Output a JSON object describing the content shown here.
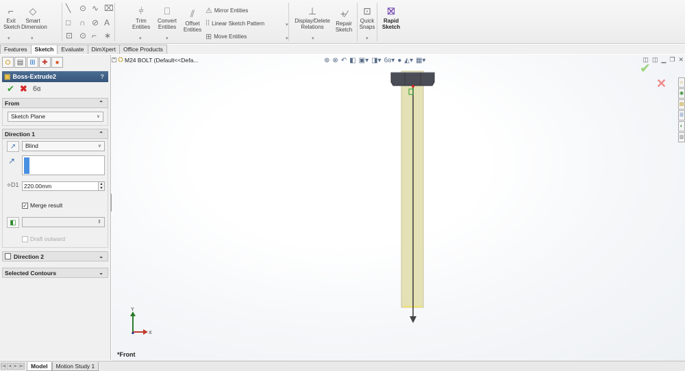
{
  "ribbon": {
    "exit_sketch": [
      "Exit",
      "Sketch"
    ],
    "smart_dimension": [
      "Smart",
      "Dimension"
    ],
    "trim": [
      "Trim",
      "Entities"
    ],
    "convert": [
      "Convert",
      "Entities"
    ],
    "offset": [
      "Offset",
      "Entities"
    ],
    "mirror": "Mirror Entities",
    "linear_pattern": "Linear Sketch Pattern",
    "move": "Move Entities",
    "display_delete": [
      "Display/Delete",
      "Relations"
    ],
    "repair": [
      "Repair",
      "Sketch"
    ],
    "quick_snaps": [
      "Quick",
      "Snaps"
    ],
    "rapid_sketch": [
      "Rapid",
      "Sketch"
    ]
  },
  "tabs": [
    "Features",
    "Sketch",
    "Evaluate",
    "DimXpert",
    "Office Products"
  ],
  "active_tab": "Sketch",
  "property_manager": {
    "title": "Boss-Extrude2",
    "help": "?",
    "from": {
      "heading": "From",
      "value": "Sketch Plane"
    },
    "direction1": {
      "heading": "Direction 1",
      "end_condition": "Blind",
      "depth": "220.00mm",
      "merge_label": "Merge result",
      "merge_checked": true,
      "draft_label": "Draft outward"
    },
    "direction2": {
      "heading": "Direction 2"
    },
    "selected_contours": {
      "heading": "Selected Contours"
    }
  },
  "tree": {
    "part": "M24 BOLT  (Default<<Defa..."
  },
  "graphics": {
    "view_label": "*Front",
    "axis_x": "X",
    "axis_y": "Y"
  },
  "bottom_tabs": [
    "Model",
    "Motion Study 1"
  ],
  "colors": {
    "ok": "#2ca02c",
    "cancel": "#d62728",
    "bolt_head": "#4a4d55",
    "bolt_shank": "#e3e1b5"
  }
}
